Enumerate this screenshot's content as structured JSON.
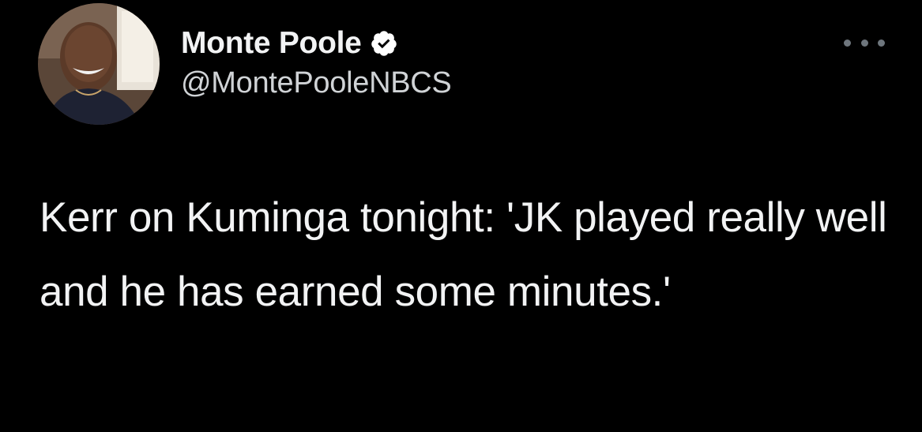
{
  "author": {
    "display_name": "Monte Poole",
    "handle": "@MontePooleNBCS",
    "verified": true,
    "verified_icon": "verified-badge-icon",
    "avatar_icon": "profile-photo"
  },
  "menu": {
    "icon": "more-options-icon"
  },
  "tweet": {
    "text": "Kerr on Kuminga tonight: 'JK played really well and he has earned some minutes.'"
  },
  "colors": {
    "background": "#000000",
    "text_primary": "#f2f3f4",
    "text_secondary": "#d0d3d6",
    "icon_muted": "#6e767d",
    "badge_fill": "#ffffff"
  }
}
